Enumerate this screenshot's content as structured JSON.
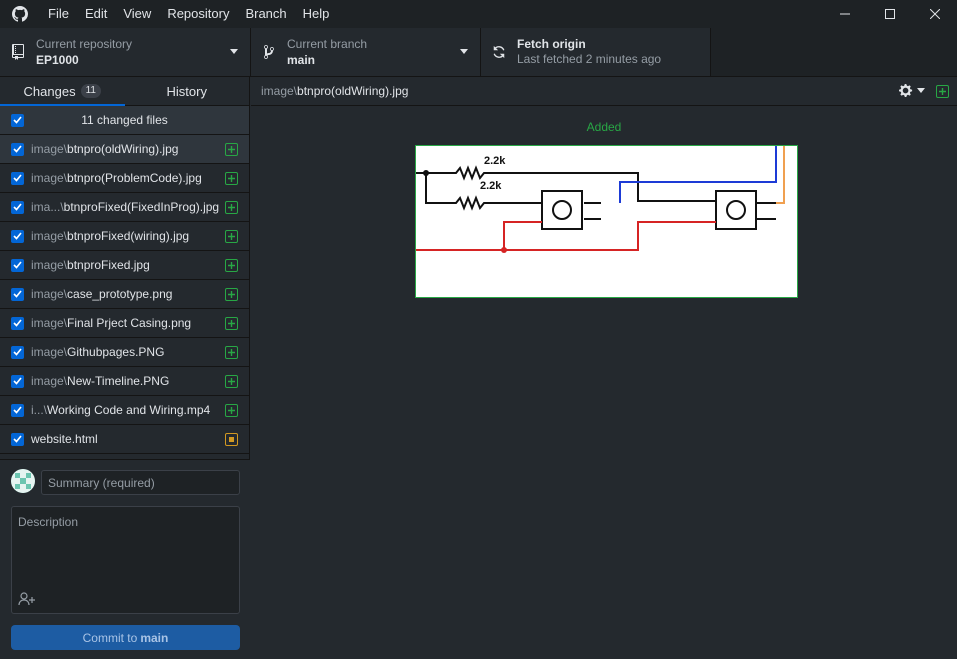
{
  "menu": [
    "File",
    "Edit",
    "View",
    "Repository",
    "Branch",
    "Help"
  ],
  "toolbar": {
    "repo_label": "Current repository",
    "repo_value": "EP1000",
    "branch_label": "Current branch",
    "branch_value": "main",
    "fetch_label": "Fetch origin",
    "fetch_sub": "Last fetched 2 minutes ago"
  },
  "tabs": {
    "changes": "Changes",
    "changes_count": "11",
    "history": "History"
  },
  "files_header": "11 changed files",
  "files": [
    {
      "dir": "image\\",
      "name": "btnpro(oldWiring).jpg",
      "status": "added"
    },
    {
      "dir": "image\\",
      "name": "btnpro(ProblemCode).jpg",
      "status": "added"
    },
    {
      "dir": "ima...\\",
      "name": "btnproFixed(FixedInProg).jpg",
      "status": "added"
    },
    {
      "dir": "image\\",
      "name": "btnproFixed(wiring).jpg",
      "status": "added"
    },
    {
      "dir": "image\\",
      "name": "btnproFixed.jpg",
      "status": "added"
    },
    {
      "dir": "image\\",
      "name": "case_prototype.png",
      "status": "added"
    },
    {
      "dir": "image\\",
      "name": "Final Prject Casing.png",
      "status": "added"
    },
    {
      "dir": "image\\",
      "name": "Githubpages.PNG",
      "status": "added"
    },
    {
      "dir": "image\\",
      "name": "New-Timeline.PNG",
      "status": "added"
    },
    {
      "dir": "i...\\",
      "name": "Working Code and Wiring.mp4",
      "status": "added"
    },
    {
      "dir": "",
      "name": "website.html",
      "status": "modified"
    }
  ],
  "commit": {
    "summary_placeholder": "Summary (required)",
    "description_placeholder": "Description",
    "button_prefix": "Commit to",
    "button_branch": "main"
  },
  "diff": {
    "path_dir": "image\\",
    "path_file": "btnpro(oldWiring).jpg",
    "status_label": "Added",
    "image_labels": [
      "2.2k",
      "2.2k"
    ]
  },
  "colors": {
    "added": "#28a745",
    "modified": "#d29922",
    "accent": "#0366d6"
  }
}
